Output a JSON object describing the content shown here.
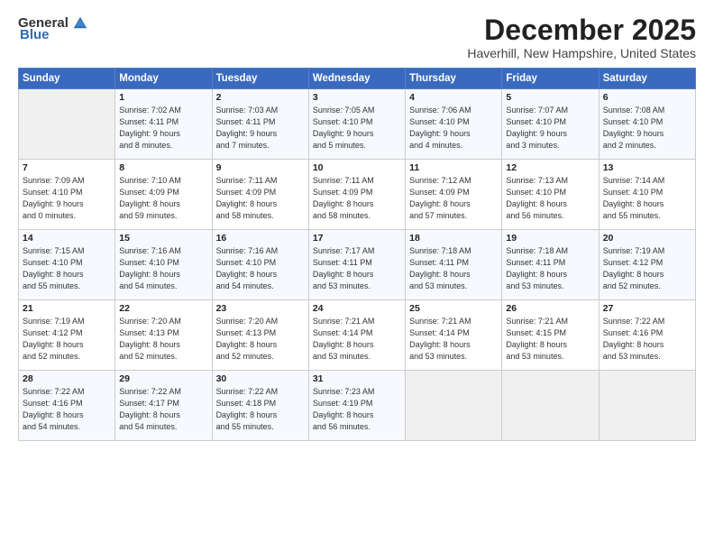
{
  "logo": {
    "general": "General",
    "blue": "Blue"
  },
  "title": "December 2025",
  "subtitle": "Haverhill, New Hampshire, United States",
  "headers": [
    "Sunday",
    "Monday",
    "Tuesday",
    "Wednesday",
    "Thursday",
    "Friday",
    "Saturday"
  ],
  "weeks": [
    [
      {
        "day": "",
        "info": ""
      },
      {
        "day": "1",
        "info": "Sunrise: 7:02 AM\nSunset: 4:11 PM\nDaylight: 9 hours\nand 8 minutes."
      },
      {
        "day": "2",
        "info": "Sunrise: 7:03 AM\nSunset: 4:11 PM\nDaylight: 9 hours\nand 7 minutes."
      },
      {
        "day": "3",
        "info": "Sunrise: 7:05 AM\nSunset: 4:10 PM\nDaylight: 9 hours\nand 5 minutes."
      },
      {
        "day": "4",
        "info": "Sunrise: 7:06 AM\nSunset: 4:10 PM\nDaylight: 9 hours\nand 4 minutes."
      },
      {
        "day": "5",
        "info": "Sunrise: 7:07 AM\nSunset: 4:10 PM\nDaylight: 9 hours\nand 3 minutes."
      },
      {
        "day": "6",
        "info": "Sunrise: 7:08 AM\nSunset: 4:10 PM\nDaylight: 9 hours\nand 2 minutes."
      }
    ],
    [
      {
        "day": "7",
        "info": "Sunrise: 7:09 AM\nSunset: 4:10 PM\nDaylight: 9 hours\nand 0 minutes."
      },
      {
        "day": "8",
        "info": "Sunrise: 7:10 AM\nSunset: 4:09 PM\nDaylight: 8 hours\nand 59 minutes."
      },
      {
        "day": "9",
        "info": "Sunrise: 7:11 AM\nSunset: 4:09 PM\nDaylight: 8 hours\nand 58 minutes."
      },
      {
        "day": "10",
        "info": "Sunrise: 7:11 AM\nSunset: 4:09 PM\nDaylight: 8 hours\nand 58 minutes."
      },
      {
        "day": "11",
        "info": "Sunrise: 7:12 AM\nSunset: 4:09 PM\nDaylight: 8 hours\nand 57 minutes."
      },
      {
        "day": "12",
        "info": "Sunrise: 7:13 AM\nSunset: 4:10 PM\nDaylight: 8 hours\nand 56 minutes."
      },
      {
        "day": "13",
        "info": "Sunrise: 7:14 AM\nSunset: 4:10 PM\nDaylight: 8 hours\nand 55 minutes."
      }
    ],
    [
      {
        "day": "14",
        "info": "Sunrise: 7:15 AM\nSunset: 4:10 PM\nDaylight: 8 hours\nand 55 minutes."
      },
      {
        "day": "15",
        "info": "Sunrise: 7:16 AM\nSunset: 4:10 PM\nDaylight: 8 hours\nand 54 minutes."
      },
      {
        "day": "16",
        "info": "Sunrise: 7:16 AM\nSunset: 4:10 PM\nDaylight: 8 hours\nand 54 minutes."
      },
      {
        "day": "17",
        "info": "Sunrise: 7:17 AM\nSunset: 4:11 PM\nDaylight: 8 hours\nand 53 minutes."
      },
      {
        "day": "18",
        "info": "Sunrise: 7:18 AM\nSunset: 4:11 PM\nDaylight: 8 hours\nand 53 minutes."
      },
      {
        "day": "19",
        "info": "Sunrise: 7:18 AM\nSunset: 4:11 PM\nDaylight: 8 hours\nand 53 minutes."
      },
      {
        "day": "20",
        "info": "Sunrise: 7:19 AM\nSunset: 4:12 PM\nDaylight: 8 hours\nand 52 minutes."
      }
    ],
    [
      {
        "day": "21",
        "info": "Sunrise: 7:19 AM\nSunset: 4:12 PM\nDaylight: 8 hours\nand 52 minutes."
      },
      {
        "day": "22",
        "info": "Sunrise: 7:20 AM\nSunset: 4:13 PM\nDaylight: 8 hours\nand 52 minutes."
      },
      {
        "day": "23",
        "info": "Sunrise: 7:20 AM\nSunset: 4:13 PM\nDaylight: 8 hours\nand 52 minutes."
      },
      {
        "day": "24",
        "info": "Sunrise: 7:21 AM\nSunset: 4:14 PM\nDaylight: 8 hours\nand 53 minutes."
      },
      {
        "day": "25",
        "info": "Sunrise: 7:21 AM\nSunset: 4:14 PM\nDaylight: 8 hours\nand 53 minutes."
      },
      {
        "day": "26",
        "info": "Sunrise: 7:21 AM\nSunset: 4:15 PM\nDaylight: 8 hours\nand 53 minutes."
      },
      {
        "day": "27",
        "info": "Sunrise: 7:22 AM\nSunset: 4:16 PM\nDaylight: 8 hours\nand 53 minutes."
      }
    ],
    [
      {
        "day": "28",
        "info": "Sunrise: 7:22 AM\nSunset: 4:16 PM\nDaylight: 8 hours\nand 54 minutes."
      },
      {
        "day": "29",
        "info": "Sunrise: 7:22 AM\nSunset: 4:17 PM\nDaylight: 8 hours\nand 54 minutes."
      },
      {
        "day": "30",
        "info": "Sunrise: 7:22 AM\nSunset: 4:18 PM\nDaylight: 8 hours\nand 55 minutes."
      },
      {
        "day": "31",
        "info": "Sunrise: 7:23 AM\nSunset: 4:19 PM\nDaylight: 8 hours\nand 56 minutes."
      },
      {
        "day": "",
        "info": ""
      },
      {
        "day": "",
        "info": ""
      },
      {
        "day": "",
        "info": ""
      }
    ]
  ]
}
